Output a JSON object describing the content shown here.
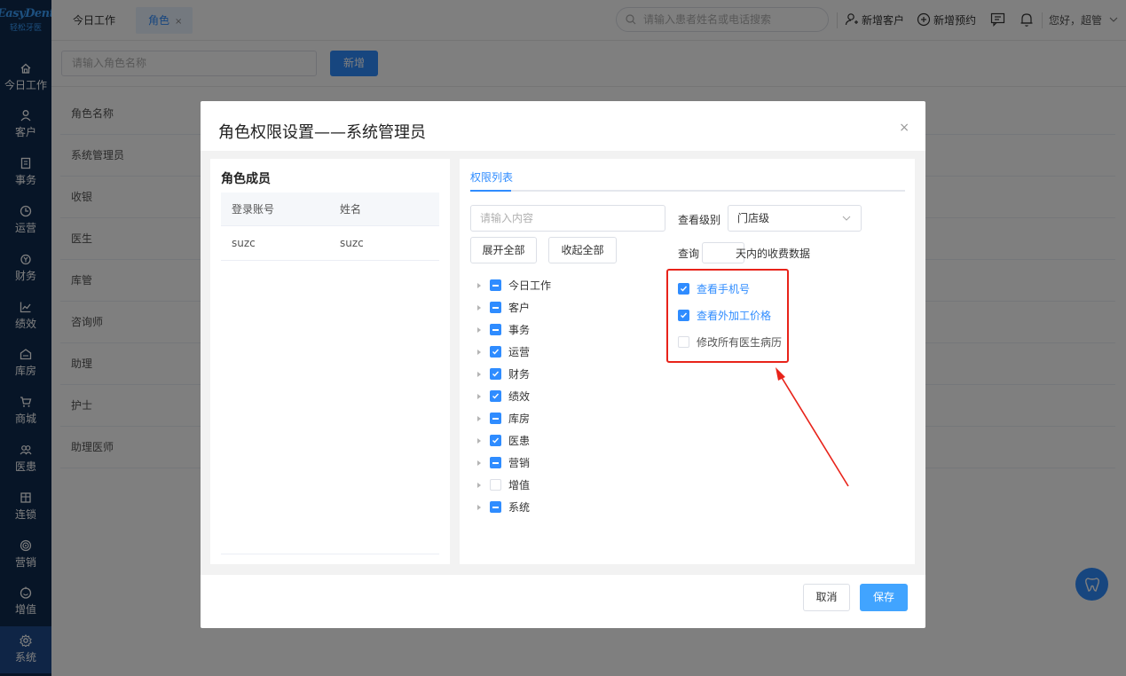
{
  "app": {
    "logo_top": "EasyDent",
    "logo_sub": "轻松牙医"
  },
  "sidebar": {
    "items": [
      {
        "label": "今日工作",
        "icon": "home-icon"
      },
      {
        "label": "客户",
        "icon": "user-icon"
      },
      {
        "label": "事务",
        "icon": "task-icon"
      },
      {
        "label": "运营",
        "icon": "clock-icon"
      },
      {
        "label": "财务",
        "icon": "money-icon"
      },
      {
        "label": "绩效",
        "icon": "chart-icon"
      },
      {
        "label": "库房",
        "icon": "warehouse-icon"
      },
      {
        "label": "商城",
        "icon": "cart-icon"
      },
      {
        "label": "医患",
        "icon": "doctor-patient-icon"
      },
      {
        "label": "连锁",
        "icon": "store-icon"
      },
      {
        "label": "营销",
        "icon": "target-icon"
      },
      {
        "label": "增值",
        "icon": "plus-smile-icon"
      },
      {
        "label": "系统",
        "icon": "gear-icon"
      }
    ],
    "active": "系统"
  },
  "topbar": {
    "tabs": [
      {
        "label": "今日工作"
      },
      {
        "label": "角色",
        "close": "×"
      }
    ],
    "search_placeholder": "请输入患者姓名或电话搜索",
    "add_customer": "新增客户",
    "add_appointment": "新增预约",
    "greeting": "您好，超管"
  },
  "page": {
    "role_input_placeholder": "请输入角色名称",
    "add_button": "新增",
    "table_header": "角色名称",
    "roles": [
      "系统管理员",
      "收银",
      "医生",
      "库管",
      "咨询师",
      "助理",
      "护士",
      "助理医师"
    ]
  },
  "modal": {
    "title": "角色权限设置——系统管理员",
    "close": "×",
    "members": {
      "title": "角色成员",
      "columns": [
        "登录账号",
        "姓名"
      ],
      "rows": [
        {
          "account": "suzc",
          "name": "suzc"
        }
      ]
    },
    "permissions": {
      "tab": "权限列表",
      "search_placeholder": "请输入内容",
      "expand_all": "展开全部",
      "collapse_all": "收起全部",
      "tree": [
        {
          "label": "今日工作",
          "state": "partial"
        },
        {
          "label": "客户",
          "state": "partial"
        },
        {
          "label": "事务",
          "state": "partial"
        },
        {
          "label": "运营",
          "state": "checked"
        },
        {
          "label": "财务",
          "state": "checked"
        },
        {
          "label": "绩效",
          "state": "checked"
        },
        {
          "label": "库房",
          "state": "partial"
        },
        {
          "label": "医患",
          "state": "checked"
        },
        {
          "label": "营销",
          "state": "partial"
        },
        {
          "label": "增值",
          "state": "empty"
        },
        {
          "label": "系统",
          "state": "partial"
        }
      ],
      "view_level_label": "查看级别",
      "view_level_value": "门店级",
      "query_prefix": "查询",
      "query_days": "",
      "query_suffix": "天内的收费数据",
      "extra": [
        {
          "label": "查看手机号",
          "checked": true
        },
        {
          "label": "查看外加工价格",
          "checked": true
        },
        {
          "label": "修改所有医生病历",
          "checked": false
        }
      ]
    },
    "cancel": "取消",
    "save": "保存"
  },
  "colors": {
    "primary": "#2f8cff",
    "sidebar": "#0e2a4f",
    "annotation": "#e8231a"
  }
}
